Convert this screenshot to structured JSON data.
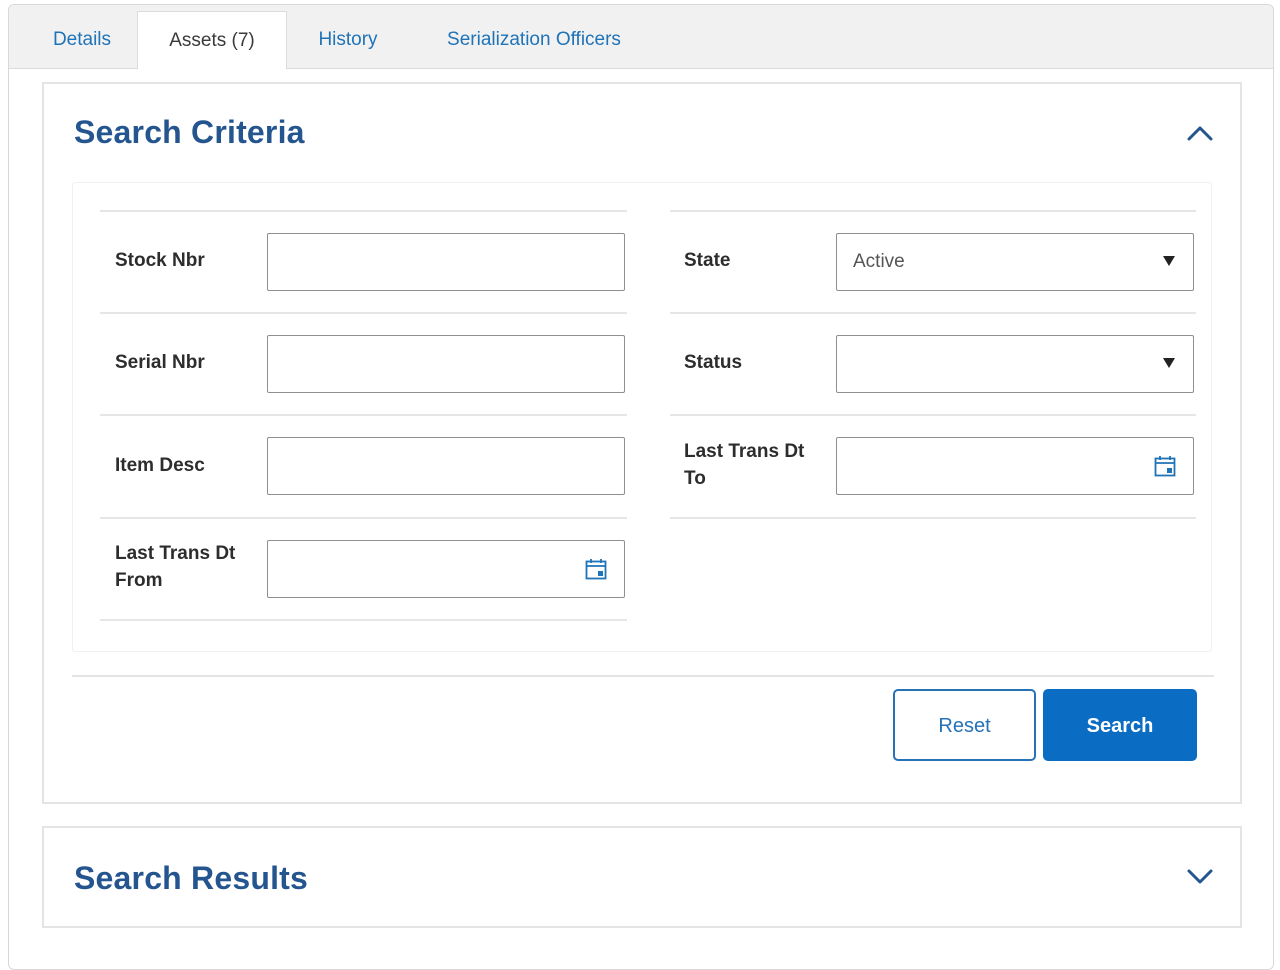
{
  "tabs": [
    {
      "label": "Details",
      "active": false
    },
    {
      "label": "Assets (7)",
      "active": true
    },
    {
      "label": "History",
      "active": false
    },
    {
      "label": "Serialization Officers",
      "active": false
    }
  ],
  "search_criteria": {
    "title": "Search Criteria",
    "expanded": true,
    "fields": {
      "stock_nbr": {
        "label": "Stock Nbr",
        "value": ""
      },
      "serial_nbr": {
        "label": "Serial Nbr",
        "value": ""
      },
      "item_desc": {
        "label": "Item Desc",
        "value": ""
      },
      "last_trans_from": {
        "label_line1": "Last Trans Dt",
        "label_line2": "From",
        "value": ""
      },
      "state": {
        "label": "State",
        "value": "Active"
      },
      "status": {
        "label": "Status",
        "value": ""
      },
      "last_trans_to": {
        "label_line1": "Last Trans Dt",
        "label_line2": "To",
        "value": ""
      }
    },
    "buttons": {
      "reset": "Reset",
      "search": "Search"
    }
  },
  "search_results": {
    "title": "Search Results",
    "expanded": false
  },
  "colors": {
    "accent": "#0a6cc2",
    "title": "#24558f",
    "tab_link": "#1f73b7"
  }
}
